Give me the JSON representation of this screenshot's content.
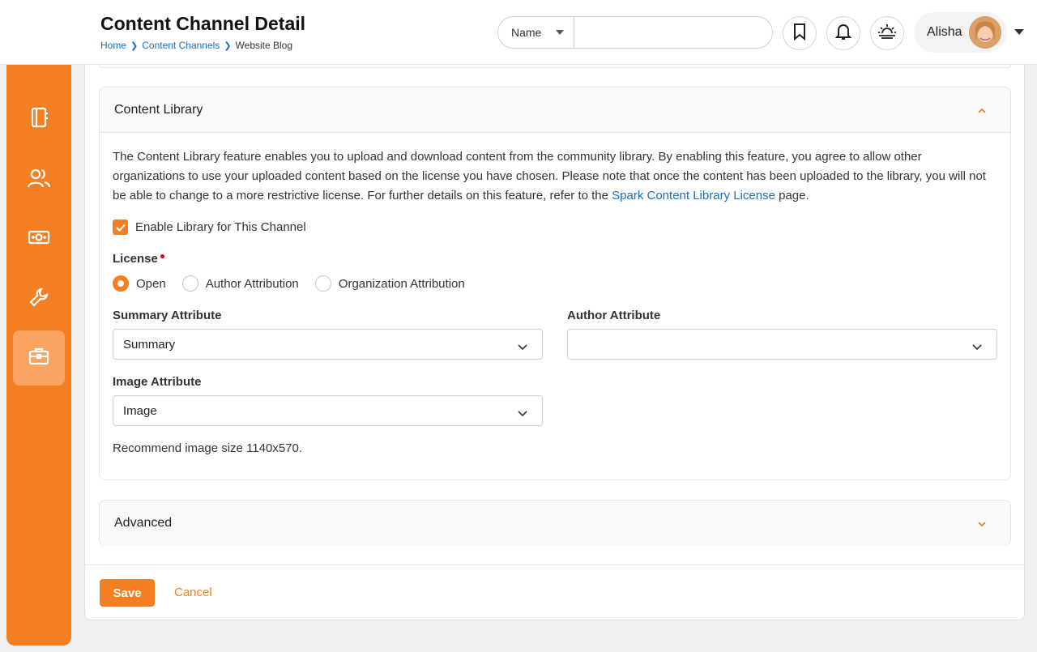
{
  "header": {
    "title": "Content Channel Detail",
    "breadcrumb": [
      "Home",
      "Content Channels",
      "Website Blog"
    ],
    "search": {
      "type_label": "Name",
      "value": "",
      "placeholder": ""
    },
    "user": {
      "name": "Alisha"
    }
  },
  "sidebar": {
    "items": [
      {
        "icon": "notebook-icon"
      },
      {
        "icon": "people-icon"
      },
      {
        "icon": "money-icon"
      },
      {
        "icon": "wrench-icon"
      },
      {
        "icon": "briefcase-icon",
        "active": true
      }
    ]
  },
  "content_library": {
    "heading": "Content Library",
    "description_before_link": "The Content Library feature enables you to upload and download content from the community library. By enabling this feature, you agree to allow other organizations to use your uploaded content based on the license you have chosen. Please note that once the content has been uploaded to the library, you will not be able to change to a more restrictive license. For further details on this feature, refer to the ",
    "description_link": "Spark Content Library License",
    "description_after_link": " page.",
    "enable_label": "Enable Library for This Channel",
    "enable_checked": true,
    "license_label": "License",
    "license_options": [
      "Open",
      "Author Attribution",
      "Organization Attribution"
    ],
    "license_selected": "Open",
    "summary_label": "Summary Attribute",
    "summary_value": "Summary",
    "author_label": "Author Attribute",
    "author_value": "",
    "image_label": "Image Attribute",
    "image_value": "Image",
    "image_hint": "Recommend image size 1140x570."
  },
  "advanced": {
    "heading": "Advanced"
  },
  "actions": {
    "save_label": "Save",
    "cancel_label": "Cancel"
  },
  "colors": {
    "accent": "#f47f22",
    "link": "#1a6fb8"
  }
}
